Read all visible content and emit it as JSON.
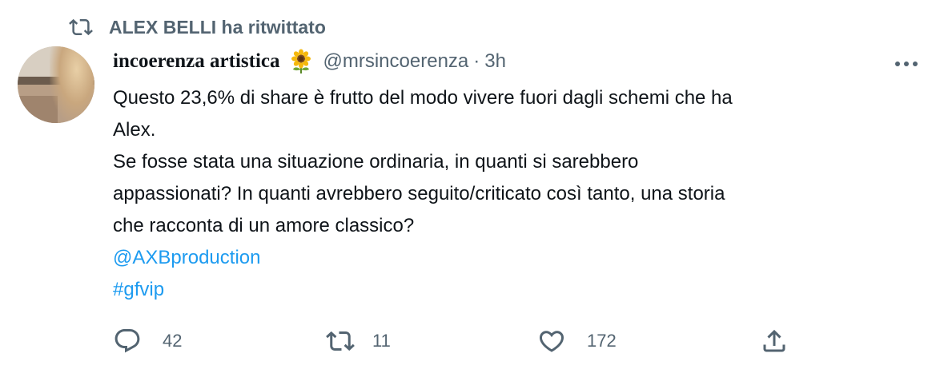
{
  "retweet_banner": {
    "text": "ALEX BELLI ha ritwittato",
    "icon": "retweet-icon"
  },
  "author": {
    "display_name": "incoerenza artistica",
    "emoji": "sunflower",
    "handle": "@mrsincoerenza",
    "separator": "·",
    "time": "3h"
  },
  "more_icon": "more-icon",
  "body": {
    "lines": [
      "Questo 23,6% di share è frutto del modo vivere fuori dagli schemi che ha",
      "Alex.",
      "Se fosse stata una situazione ordinaria, in quanti si sarebbero",
      "appassionati? In quanti avrebbero seguito/criticato così tanto, una storia",
      "che racconta di un amore classico?"
    ],
    "mention": "@AXBproduction",
    "hashtag": "#gfvip"
  },
  "actions": {
    "reply": {
      "icon": "reply-icon",
      "count": "42"
    },
    "retweet": {
      "icon": "retweet-icon",
      "count": "11"
    },
    "like": {
      "icon": "heart-icon",
      "count": "172"
    },
    "share": {
      "icon": "share-icon"
    }
  },
  "colors": {
    "text": "#0f1419",
    "secondary": "#536471",
    "link": "#1d9bf0"
  }
}
